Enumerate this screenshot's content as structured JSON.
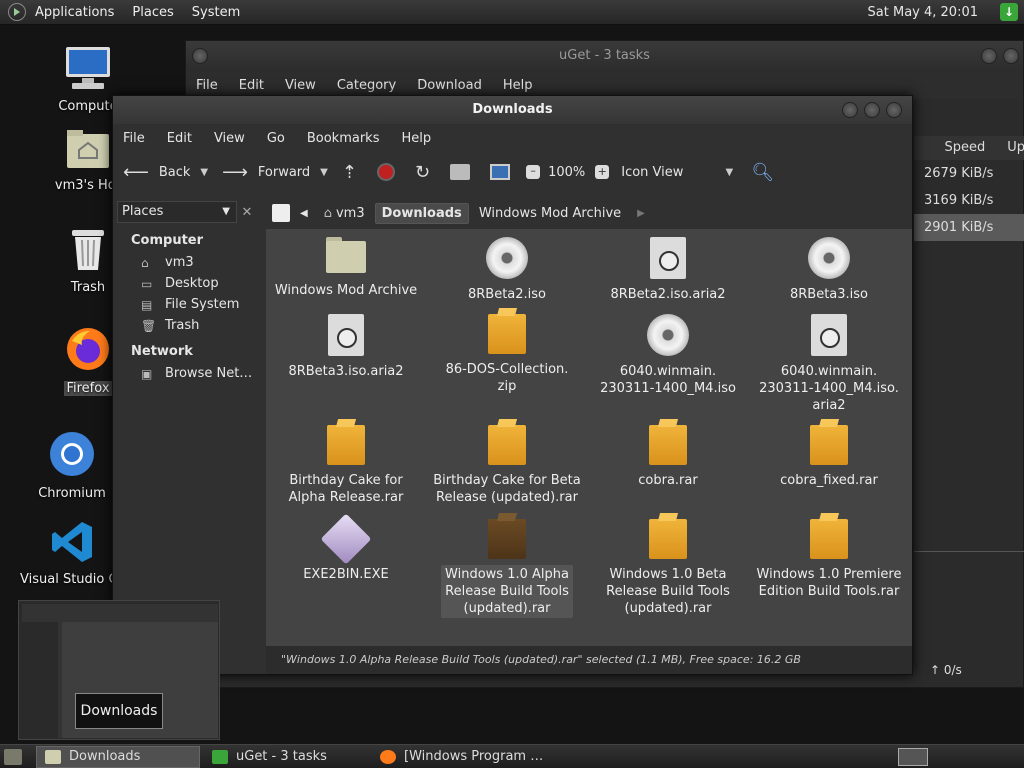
{
  "top_panel": {
    "menus": [
      "Applications",
      "Places",
      "System"
    ],
    "clock": "Sat May 4, 20:01"
  },
  "desktop": {
    "icons": [
      {
        "label": "Compute",
        "icon": "computer-icon"
      },
      {
        "label": "vm3's Hor",
        "icon": "home-folder-icon"
      },
      {
        "label": "Trash",
        "icon": "trash-icon"
      },
      {
        "label": "Firefox",
        "icon": "firefox-icon"
      },
      {
        "label": "Chromium",
        "icon": "chromium-icon"
      },
      {
        "label": "Visual Studio Co",
        "icon": "vscode-icon"
      }
    ]
  },
  "uget": {
    "title": "uGet - 3 tasks",
    "menu": [
      "File",
      "Edit",
      "View",
      "Category",
      "Download",
      "Help"
    ],
    "columns": [
      "Speed",
      "Up"
    ],
    "speeds": [
      "2679 KiB/s",
      "3169 KiB/s",
      "2901 KiB/s"
    ],
    "upload_status": "↑ 0/s"
  },
  "downloads": {
    "title": "Downloads",
    "menu": [
      "File",
      "Edit",
      "View",
      "Go",
      "Bookmarks",
      "Help"
    ],
    "toolbar": {
      "back": "Back",
      "forward": "Forward",
      "zoom": "100%",
      "view_mode": "Icon View"
    },
    "sidebar": {
      "selector": "Places",
      "computer_header": "Computer",
      "computer_items": [
        "vm3",
        "Desktop",
        "File System",
        "Trash"
      ],
      "network_header": "Network",
      "network_items": [
        "Browse Net…"
      ]
    },
    "breadcrumbs": [
      "vm3",
      "Downloads",
      "Windows Mod Archive"
    ],
    "files": [
      {
        "name": "Windows Mod Archive",
        "type": "folder"
      },
      {
        "name": "8RBeta2.iso",
        "type": "disc"
      },
      {
        "name": "8RBeta2.iso.aria2",
        "type": "aria"
      },
      {
        "name": "8RBeta3.iso",
        "type": "disc"
      },
      {
        "name": "8RBeta3.iso.aria2",
        "type": "aria"
      },
      {
        "name": "86-DOS-Collection.\nzip",
        "type": "archive"
      },
      {
        "name": "6040.winmain.\n230311-1400_M4.iso",
        "type": "disc"
      },
      {
        "name": "6040.winmain.\n230311-1400_M4.iso.\naria2",
        "type": "aria"
      },
      {
        "name": "Birthday Cake for\nAlpha Release.rar",
        "type": "archive"
      },
      {
        "name": "Birthday Cake for Beta\nRelease (updated).rar",
        "type": "archive"
      },
      {
        "name": "cobra.rar",
        "type": "archive"
      },
      {
        "name": "cobra_fixed.rar",
        "type": "archive"
      },
      {
        "name": "EXE2BIN.EXE",
        "type": "exe"
      },
      {
        "name": "Windows 1.0 Alpha\nRelease Build Tools\n(updated).rar",
        "type": "archive-dark",
        "selected": true
      },
      {
        "name": "Windows 1.0 Beta\nRelease Build Tools\n(updated).rar",
        "type": "archive"
      },
      {
        "name": "Windows 1.0 Premiere\nEdition Build Tools.rar",
        "type": "archive"
      }
    ],
    "status": "\"Windows 1.0 Alpha Release Build Tools (updated).rar\" selected (1.1 MB), Free space: 16.2 GB"
  },
  "preview": {
    "tooltip": "Downloads"
  },
  "taskbar": {
    "tasks": [
      {
        "label": "Downloads",
        "active": true
      },
      {
        "label": "uGet - 3 tasks",
        "active": false
      },
      {
        "label": "[Windows Program …",
        "active": false
      }
    ]
  }
}
